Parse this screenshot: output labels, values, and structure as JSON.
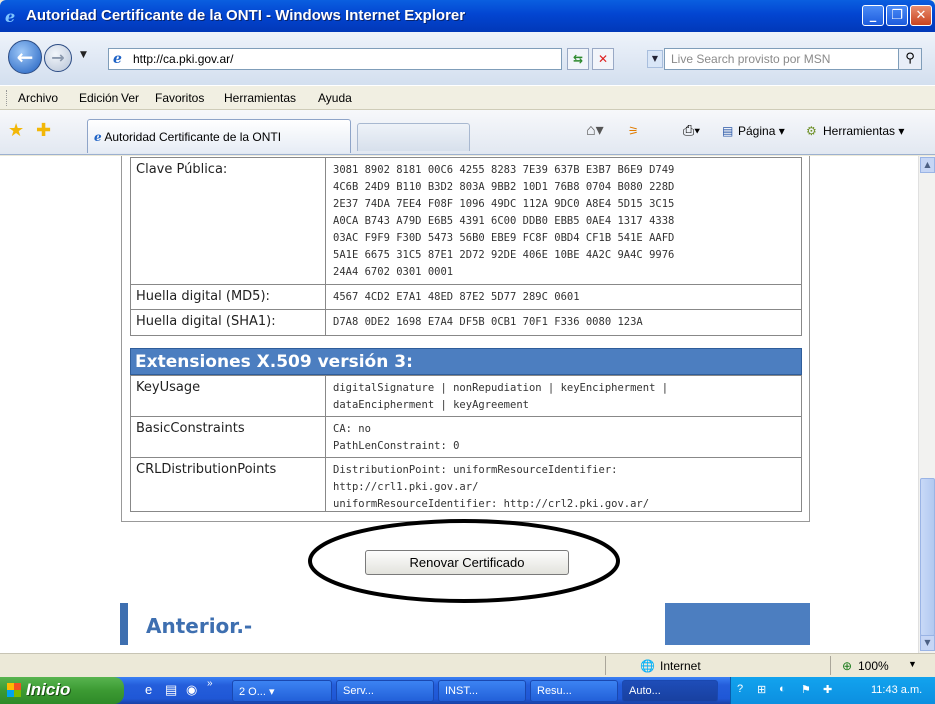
{
  "window": {
    "title": "Autoridad Certificante de la ONTI - Windows Internet Explorer",
    "min": "_",
    "max": "❐",
    "close": "✕"
  },
  "address": {
    "url": "http://ca.pki.gov.ar/",
    "search_placeholder": "Live Search provisto por MSN"
  },
  "menu": [
    "Archivo",
    "Edición",
    "Ver",
    "Favoritos",
    "Herramientas",
    "Ayuda"
  ],
  "tab": {
    "title": "Autoridad Certificante de la ONTI"
  },
  "toolbar": {
    "pagina": "Página ▾",
    "herramientas": "Herramientas ▾"
  },
  "cert": {
    "public_key_label": "Clave Pública:",
    "public_key_value": "3081 8902 8181 00C6 4255 8283 7E39 637B E3B7 B6E9 D749\n4C6B 24D9 B110 B3D2 803A 9BB2 10D1 76B8 0704 B080 228D\n2E37 74DA 7EE4 F08F 1096 49DC 112A 9DC0 A8E4 5D15 3C15\nA0CA B743 A79D E6B5 4391 6C00 DDB0 EBB5 0AE4 1317 4338\n03AC F9F9 F30D 5473 56B0 EBE9 FC8F 0BD4 CF1B 541E AAFD\n5A1E 6675 31C5 87E1 2D72 92DE 406E 10BE 4A2C 9A4C 9976\n24A4 6702 0301 0001",
    "md5_label": "Huella digital (MD5):",
    "md5_value": "4567 4CD2 E7A1 48ED 87E2 5D77 289C 0601",
    "sha1_label": "Huella digital (SHA1):",
    "sha1_value": "D7A8 0DE2 1698 E7A4 DF5B 0CB1 70F1 F336 0080 123A",
    "ext_header": "Extensiones X.509 versión 3:",
    "keyusage_label": "KeyUsage",
    "keyusage_value": "digitalSignature | nonRepudiation | keyEncipherment |\ndataEncipherment | keyAgreement",
    "basic_label": "BasicConstraints",
    "basic_value": "CA: no\nPathLenConstraint: 0",
    "crl_label": "CRLDistributionPoints",
    "crl_value": "DistributionPoint: uniformResourceIdentifier:\nhttp://crl1.pki.gov.ar/\nuniformResourceIdentifier: http://crl2.pki.gov.ar/"
  },
  "renew_button": "Renovar Certificado",
  "anterior": "Anterior.-",
  "status": {
    "zone": "Internet",
    "zoom": "100%"
  },
  "taskbar": {
    "start": "Inicio",
    "tasks": [
      "2 O...",
      "Serv...",
      "INST...",
      "Resu...",
      "Auto..."
    ],
    "clock": "11:43 a.m."
  }
}
